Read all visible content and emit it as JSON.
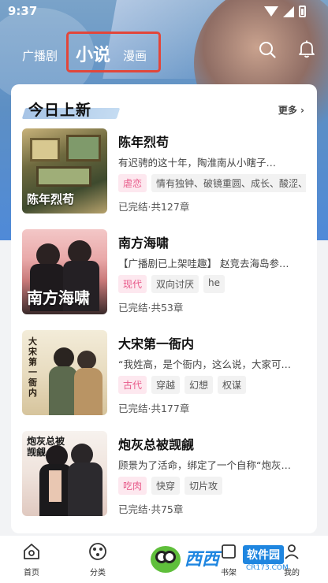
{
  "status_bar": {
    "time": "9:37"
  },
  "top_nav": {
    "tabs": [
      {
        "label": "广播剧"
      },
      {
        "label": "小说"
      },
      {
        "label": "漫画"
      }
    ]
  },
  "section": {
    "title": "今日上新",
    "more_label": "更多"
  },
  "books": [
    {
      "title": "陈年烈苟",
      "description": "有迟骋的这十年，陶淮南从小瞎子…",
      "tags": [
        "虐恋",
        "情有独钟、破镜重圆、成长、酸涩、"
      ],
      "status": "已完结·共127章",
      "cover_text": "陈年烈苟"
    },
    {
      "title": "南方海啸",
      "description": "【广播剧已上架哇趣】 赵竞去海岛参…",
      "tags": [
        "现代",
        "双向讨厌",
        "he"
      ],
      "status": "已完结·共53章",
      "cover_text": "南方海啸"
    },
    {
      "title": "大宋第一衙内",
      "description": "“我姓高，是个衙内，这么说，大家可…",
      "tags": [
        "古代",
        "穿越",
        "幻想",
        "权谋"
      ],
      "status": "已完结·共177章",
      "cover_text": "大宋第一衙内"
    },
    {
      "title": "炮灰总被觊觎",
      "description": "顾景为了活命，绑定了一个自称“炮灰…",
      "tags": [
        "吃肉",
        "快穿",
        "切片攻"
      ],
      "status": "已完结·共75章",
      "cover_text": "炮灰总被觊觎"
    }
  ],
  "bottom_nav": {
    "items": [
      {
        "label": "首页"
      },
      {
        "label": "分类"
      },
      {
        "label": "书架"
      },
      {
        "label": "我的"
      }
    ]
  },
  "watermark": {
    "brand": "西西",
    "badge": "软件园",
    "url": "CR173.COM"
  },
  "colors": {
    "highlight_box": "#e2463a",
    "accent_pink": "#e85a8a",
    "tag_pink_bg": "#fde8ef"
  }
}
